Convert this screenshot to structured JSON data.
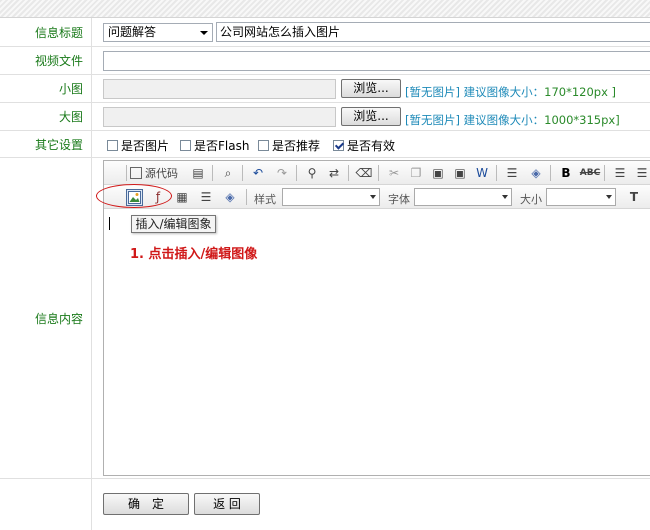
{
  "form": {
    "title_label": "信息标题",
    "title_category": "问题解答",
    "title_value": "公司网站怎么插入图片",
    "video_label": "视频文件",
    "video_value": "",
    "small_label": "小图",
    "small_browse": "浏览...",
    "small_no_image": "[暂无图片]",
    "small_hint_prefix": "建议图像大小：",
    "small_hint_size": "170*120px ]",
    "large_label": "大图",
    "large_browse": "浏览...",
    "large_no_image": "[暂无图片]",
    "large_hint_prefix": "建议图像大小：",
    "large_hint_size": "1000*315px]",
    "other_label": "其它设置",
    "checkboxes": [
      {
        "label": "是否图片",
        "checked": false
      },
      {
        "label": "是否Flash",
        "checked": false
      },
      {
        "label": "是否推荐",
        "checked": false
      },
      {
        "label": "是否有效",
        "checked": true
      }
    ],
    "content_label": "信息内容"
  },
  "editor": {
    "source_label": "源代码",
    "style_label": "样式",
    "font_label": "字体",
    "size_label": "大小",
    "tooltip": "插入/编辑图象",
    "annotation": "1. 点击插入/编辑图像"
  },
  "actions": {
    "confirm": "确　定",
    "back": "返 回"
  },
  "colors": {
    "label_green": "#1a7a1a",
    "link_blue": "#1e8ab8",
    "annotation_red": "#d01818"
  }
}
